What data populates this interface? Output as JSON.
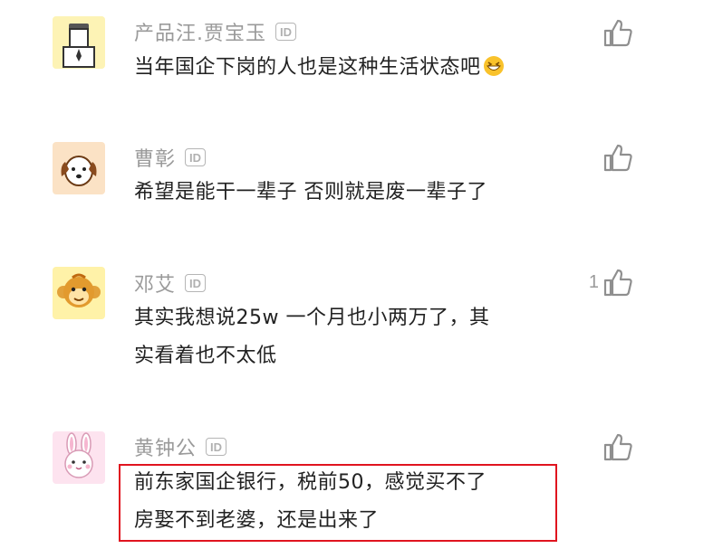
{
  "comments": [
    {
      "author": "产品汪.贾宝玉",
      "id_badge": "ID",
      "lines": [
        "当年国企下岗的人也是这种生活状态吧"
      ],
      "emoji": "grinning-face",
      "likes": "",
      "avatar": "office-worker-avatar"
    },
    {
      "author": "曹彰",
      "id_badge": "ID",
      "lines": [
        "希望是能干一辈子 否则就是废一辈子了"
      ],
      "likes": "",
      "avatar": "dog-avatar"
    },
    {
      "author": "邓艾",
      "id_badge": "ID",
      "lines": [
        "其实我想说25w 一个月也小两万了，其",
        "实看着也不太低"
      ],
      "likes": "1",
      "avatar": "monkey-avatar"
    },
    {
      "author": "黄钟公",
      "id_badge": "ID",
      "lines": [
        "前东家国企银行，税前50，感觉买不了",
        "房娶不到老婆，还是出来了"
      ],
      "likes": "",
      "avatar": "rabbit-avatar",
      "highlighted": true
    }
  ],
  "colors": {
    "author": "#9a9a9a",
    "text": "#222222",
    "highlight": "#e0141f"
  }
}
